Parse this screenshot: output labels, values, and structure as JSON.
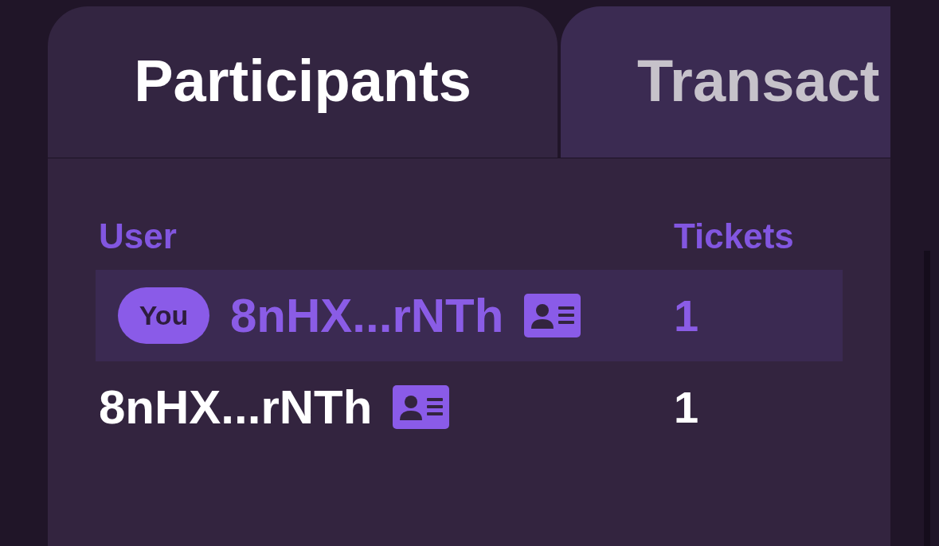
{
  "tabs": [
    {
      "label": "Participants",
      "selected": true
    },
    {
      "label": "Transact",
      "selected": false
    }
  ],
  "table": {
    "columns": [
      "User",
      "Tickets"
    ],
    "rows": [
      {
        "badge": "You",
        "user": "8nHX...rNTh",
        "tickets": "1",
        "highlighted": true
      },
      {
        "user": "8nHX...rNTh",
        "tickets": "1",
        "highlighted": false
      }
    ]
  }
}
